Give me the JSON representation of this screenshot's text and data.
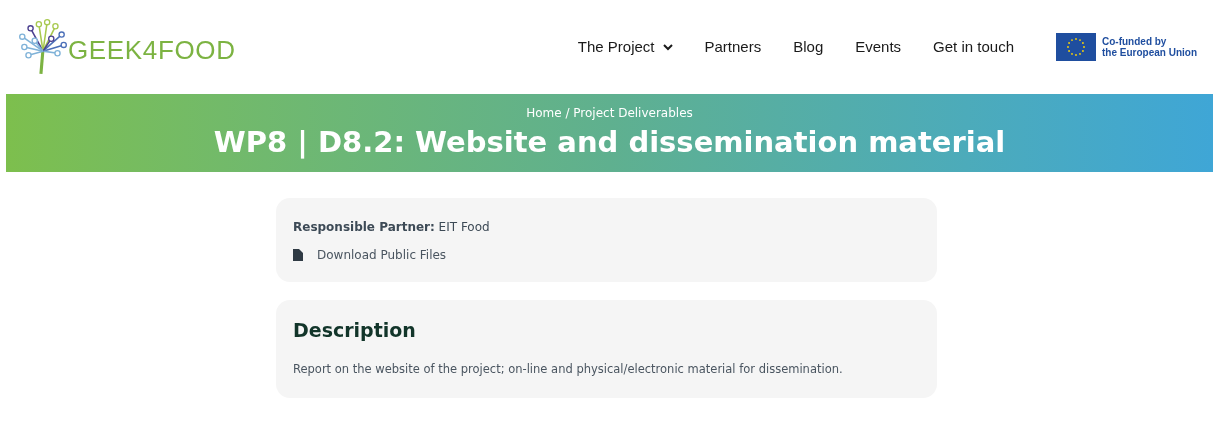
{
  "logo": {
    "text": "GEEK4FOOD"
  },
  "nav": [
    {
      "label": "The Project",
      "kind": "dropdown"
    },
    {
      "label": "Partners",
      "kind": "link"
    },
    {
      "label": "Blog",
      "kind": "link"
    },
    {
      "label": "Events",
      "kind": "link"
    },
    {
      "label": "Get in touch",
      "kind": "link"
    }
  ],
  "eu_badge": {
    "lines": [
      "Co-funded by",
      "the European Union"
    ]
  },
  "hero": {
    "breadcrumb": "Home / Project Deliverables",
    "title": "WP8 | D8.2: Website and dissemination material"
  },
  "info_card": {
    "partner": "**Responsible Partner:** EIT Food",
    "download": "Download Public Files"
  },
  "description_card": {
    "heading": "Description",
    "text": "Report on the website of the project; on-line and physical/electronic material for dissemination."
  }
}
